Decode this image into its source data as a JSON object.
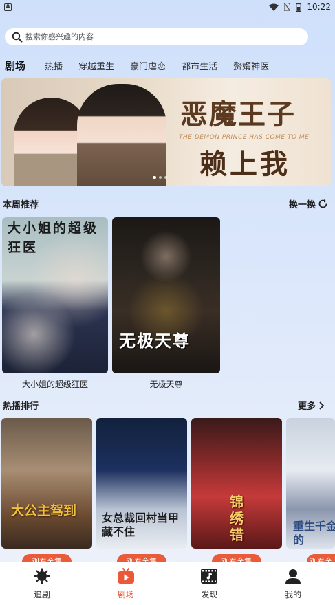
{
  "status_bar": {
    "time": "10:22",
    "left_badge": "A"
  },
  "search": {
    "placeholder": "搜索你感兴趣的内容"
  },
  "tabs": [
    {
      "label": "剧场",
      "active": true
    },
    {
      "label": "热播"
    },
    {
      "label": "穿越重生"
    },
    {
      "label": "豪门虐恋"
    },
    {
      "label": "都市生活"
    },
    {
      "label": "赘婿神医"
    }
  ],
  "banner": {
    "title_line1": "恶魔王子",
    "title_line2": "赖上我",
    "subtitle": "THE DEMON PRINCE HAS COME TO ME",
    "page_count": 3,
    "active_index": 0
  },
  "weekly": {
    "title": "本周推荐",
    "action": "换一换",
    "items": [
      {
        "name": "大小姐的超级狂医",
        "poster_text": "大小姐的超级狂医"
      },
      {
        "name": "无极天尊",
        "poster_text": "无极天尊"
      }
    ]
  },
  "hot": {
    "title": "热播排行",
    "action": "更多",
    "button_label": "观看全集",
    "items": [
      {
        "poster_text": "大公主驾到"
      },
      {
        "poster_text": "女总裁回村当甲藏不住"
      },
      {
        "poster_text": "锦绣错"
      },
      {
        "poster_text": "重生千金的"
      }
    ]
  },
  "nav": [
    {
      "label": "追剧",
      "icon": "follow-icon"
    },
    {
      "label": "剧场",
      "icon": "theater-icon",
      "active": true
    },
    {
      "label": "发现",
      "icon": "discover-icon"
    },
    {
      "label": "我的",
      "icon": "profile-icon"
    }
  ],
  "colors": {
    "accent": "#ea5b3a",
    "nav_active": "#e85a3a"
  }
}
